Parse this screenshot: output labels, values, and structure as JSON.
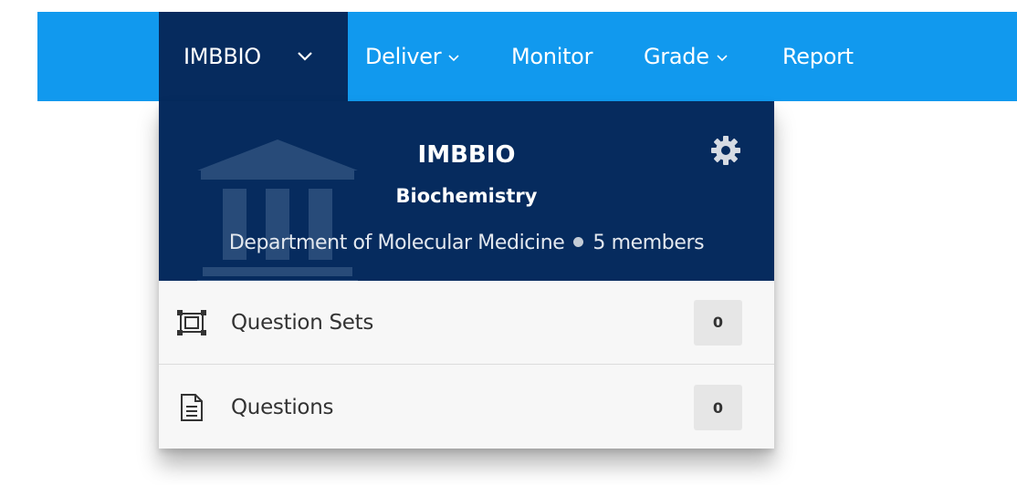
{
  "navbar": {
    "org_label": "IMBBIO",
    "items": [
      {
        "label": "Deliver",
        "has_menu": true
      },
      {
        "label": "Monitor",
        "has_menu": false
      },
      {
        "label": "Grade",
        "has_menu": true
      },
      {
        "label": "Report",
        "has_menu": false
      }
    ]
  },
  "dropdown": {
    "org_name": "IMBBIO",
    "org_subtitle": "Biochemistry",
    "department": "Department of Molecular Medicine",
    "members": "5 members",
    "rows": [
      {
        "label": "Question Sets",
        "count": "0",
        "icon": "question-sets-icon"
      },
      {
        "label": "Questions",
        "count": "0",
        "icon": "document-icon"
      }
    ]
  },
  "colors": {
    "navbar": "#1199ee",
    "org_dark": "#062b5e",
    "menu_bg": "#f7f7f7",
    "badge_bg": "#e6e6e6"
  }
}
